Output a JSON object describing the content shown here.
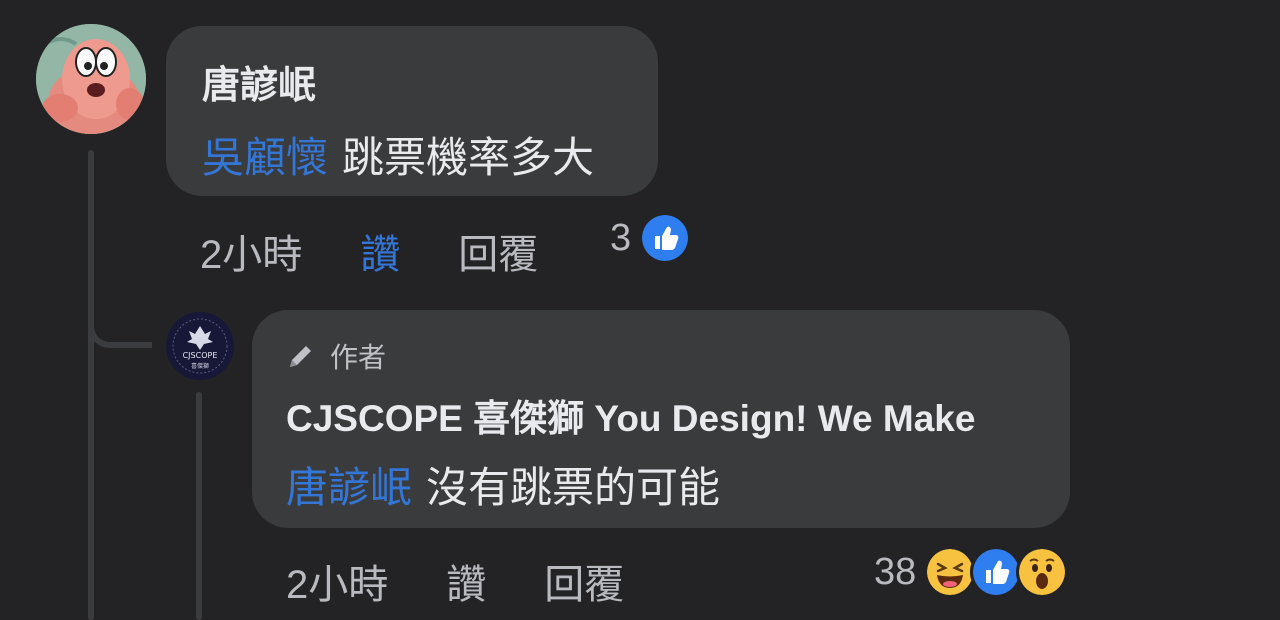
{
  "comment": {
    "author": "唐諺岷",
    "mention": "吳顧懷",
    "text": "跳票機率多大",
    "time": "2小時",
    "like_label": "讚",
    "reply_label": "回覆",
    "reaction_count": "3",
    "reactions": [
      "like-icon"
    ]
  },
  "reply": {
    "badge": "作者",
    "author": "CJSCOPE 喜傑獅 You Design! We Make",
    "mention": "唐諺岷",
    "text": "沒有跳票的可能",
    "time": "2小時",
    "like_label": "讚",
    "reply_label": "回覆",
    "reaction_count": "38",
    "reactions": [
      "haha-icon",
      "like-icon",
      "wow-icon"
    ]
  },
  "avatar_reply": {
    "logo_text": "CJSCOPE",
    "logo_sub": "喜傑獅"
  },
  "colors": {
    "background": "#232325",
    "bubble": "#3a3b3c",
    "mention": "#3476d6",
    "text": "#e9eaee",
    "meta": "#b8babf"
  }
}
